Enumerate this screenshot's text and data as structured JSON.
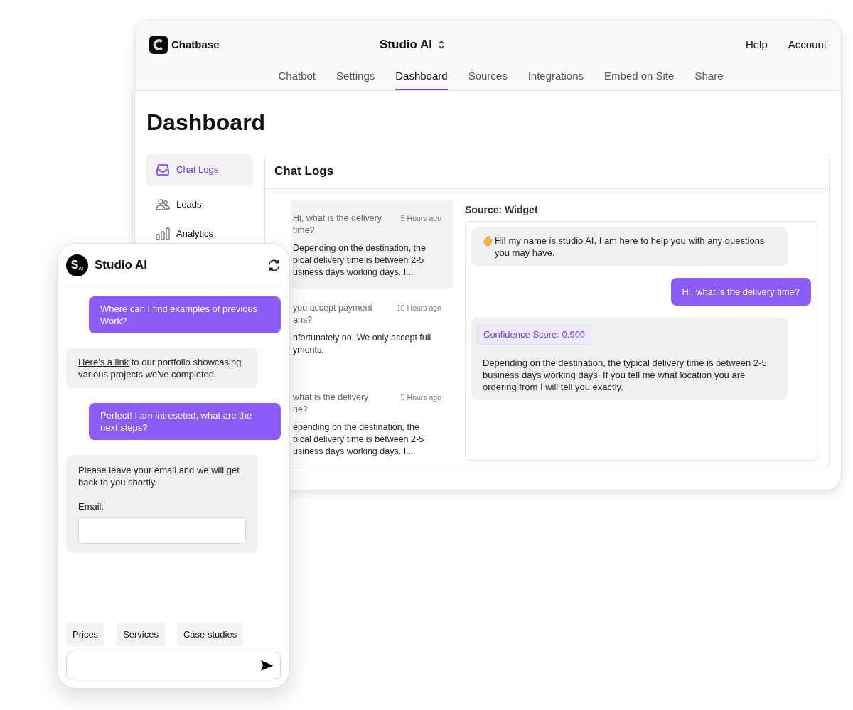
{
  "dashboard": {
    "brand": "Chatbase",
    "bot_name": "Studio AI",
    "header_links": [
      "Help",
      "Account"
    ],
    "tabs": [
      {
        "label": "Chatbot",
        "selected": false
      },
      {
        "label": "Settings",
        "selected": false
      },
      {
        "label": "Dashboard",
        "selected": true
      },
      {
        "label": "Sources",
        "selected": false
      },
      {
        "label": "Integrations",
        "selected": false
      },
      {
        "label": "Embed on Site",
        "selected": false
      },
      {
        "label": "Share",
        "selected": false
      }
    ],
    "title": "Dashboard",
    "sidebar": [
      {
        "label": "Chat Logs",
        "selected": true
      },
      {
        "label": "Leads",
        "selected": false
      },
      {
        "label": "Analytics",
        "selected": false
      }
    ],
    "panel_title": "Chat Logs",
    "chat_logs": [
      {
        "question_lines": [
          "Hi, what is the delivery",
          "time?"
        ],
        "time": "5 Hours ago",
        "answer_lines": [
          "Depending on the destination, the",
          "pical delivery time is between 2-5",
          "usiness days working days. I..."
        ],
        "selected": true
      },
      {
        "question_lines": [
          "you accept payment",
          "ans?"
        ],
        "time": "10 Hours ago",
        "answer_lines": [
          "nfortunately no! We only accept full",
          "yments."
        ],
        "selected": false
      },
      {
        "question_lines": [
          "what is the delivery",
          "ne?"
        ],
        "time": "5 Hours ago",
        "answer_lines": [
          "epending on the destination, the",
          "pical delivery time is between 2-5",
          "usiness days working days. I..."
        ],
        "selected": false
      }
    ],
    "source": "Source: Widget",
    "conversation": [
      {
        "kind": "bot",
        "wave": true,
        "text": "Hi! my name is studio AI, I am here to help you with any questions you may have."
      },
      {
        "kind": "user",
        "text": "Hi, what is the delivery time?"
      },
      {
        "kind": "bot",
        "badge": "Confidence Score: 0.900",
        "text": "Depending on the destination, the typical delivery time is between 2-5 business days working days. If you tell me what location you are ordering from I will tell you exactly."
      }
    ]
  },
  "phone": {
    "avatar": {
      "letter": "S",
      "sub": "AI"
    },
    "title": "Studio AI",
    "messages": [
      {
        "kind": "user",
        "text": "Where can I find examples of previous Work?"
      },
      {
        "kind": "link",
        "link": "Here's a link",
        "text": " to our portfolio showcasing various projects we've completed."
      },
      {
        "kind": "user",
        "text": "Perfect! I am intreseted, what are the next steps?"
      },
      {
        "kind": "form",
        "text": "Please leave your email and we will get back to you shortly.",
        "label": "Email:"
      }
    ],
    "suggestions": [
      "Prices",
      "Services",
      "Case studies"
    ]
  }
}
